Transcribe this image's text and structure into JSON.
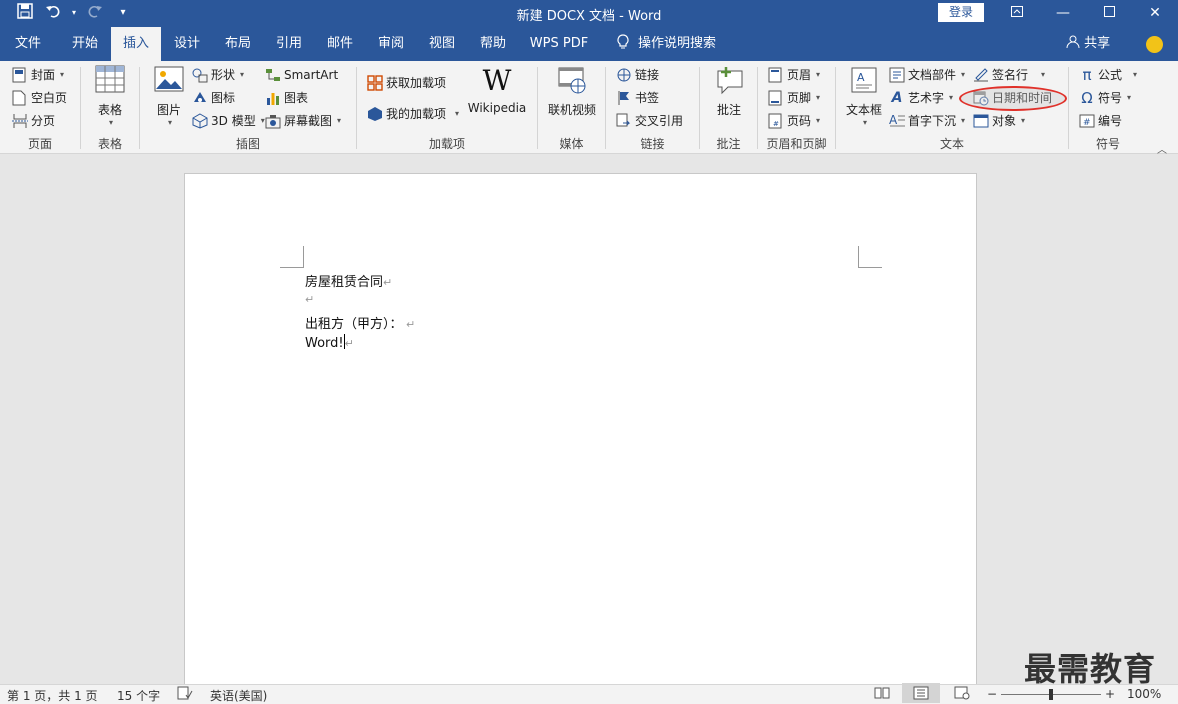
{
  "title_bar": {
    "title": "新建 DOCX 文档 - Word",
    "login_label": "登录",
    "qat": {
      "save_icon": "save-icon",
      "undo_icon": "undo-icon",
      "redo_icon": "redo-icon",
      "customize_icon": "customize-qat-icon"
    },
    "window_controls": [
      "ribbon-display-icon",
      "minimize-icon",
      "maximize-icon",
      "close-icon"
    ]
  },
  "tabs": [
    {
      "label": "文件"
    },
    {
      "label": "开始"
    },
    {
      "label": "插入"
    },
    {
      "label": "设计"
    },
    {
      "label": "布局"
    },
    {
      "label": "引用"
    },
    {
      "label": "邮件"
    },
    {
      "label": "审阅"
    },
    {
      "label": "视图"
    },
    {
      "label": "帮助"
    },
    {
      "label": "WPS PDF"
    },
    {
      "label": "操作说明搜索"
    }
  ],
  "active_tab": "插入",
  "share_label": "共享",
  "ribbon": {
    "pages": {
      "label": "页面",
      "cover": "封面",
      "blank": "空白页",
      "break": "分页"
    },
    "tables": {
      "label": "表格",
      "table": "表格"
    },
    "illustrations": {
      "label": "插图",
      "picture": "图片",
      "shapes": "形状",
      "icons": "图标",
      "model3d": "3D 模型",
      "smartart": "SmartArt",
      "chart": "图表",
      "screenshot": "屏幕截图"
    },
    "addins": {
      "label": "加载项",
      "get": "获取加载项",
      "my": "我的加载项",
      "wikipedia": "Wikipedia"
    },
    "media": {
      "label": "媒体",
      "video": "联机视频"
    },
    "links": {
      "label": "链接",
      "link": "链接",
      "bookmark": "书签",
      "crossref": "交叉引用"
    },
    "comments": {
      "label": "批注",
      "comment": "批注"
    },
    "header_footer": {
      "label": "页眉和页脚",
      "header": "页眉",
      "footer": "页脚",
      "page_number": "页码"
    },
    "text": {
      "label": "文本",
      "textbox": "文本框",
      "quickparts": "文档部件",
      "wordart": "艺术字",
      "dropcap": "首字下沉",
      "signature": "签名行",
      "datetime": "日期和时间",
      "object": "对象"
    },
    "symbols": {
      "label": "符号",
      "equation": "公式",
      "symbol": "符号",
      "number": "编号"
    }
  },
  "document": {
    "lines": [
      "房屋租赁合同",
      "",
      "出租方（甲方）：",
      "Word!"
    ]
  },
  "watermark": "最需教育",
  "status": {
    "page": "第 1 页，共 1 页",
    "words": "15 个字",
    "language": "英语(美国)",
    "zoom": "100%",
    "zoom_minus": "−",
    "zoom_plus": "+"
  }
}
